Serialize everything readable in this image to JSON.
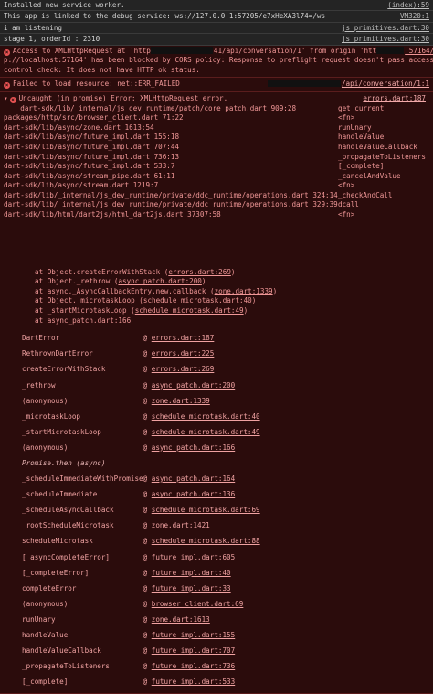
{
  "console": {
    "info_rows": [
      {
        "text": "Installed new service worker.",
        "link": "(index):59"
      },
      {
        "text": "This app is linked to the debug service: ws://127.0.0.1:57205/e7xHeXA3l74=/ws",
        "link": "VM320:1"
      },
      {
        "text": "i am listening",
        "link": "js_primitives.dart:30"
      },
      {
        "text": "stage 1, orderId : 2310",
        "link": "js_primitives.dart:30"
      }
    ],
    "cors_error": {
      "line1_a": "Access to XMLHttpRequest at 'http",
      "line1_b": "41/api/conversation/1' from origin 'htt",
      "line1_c": ":57164/#/:1",
      "line2": "p://localhost:57164' has been blocked by CORS policy: Response to preflight request doesn't pass access",
      "line3": "control check: It does not have HTTP ok status."
    },
    "failed_load": {
      "text": "Failed to load resource: net::ERR_FAILED",
      "link": "/api/conversation/1:1"
    },
    "uncaught": {
      "header": "Uncaught (in promise) Error: XMLHttpRequest error.",
      "link": "errors.dart:187",
      "grid": [
        {
          "l": "    dart-sdk/lib/_internal/js_dev_runtime/patch/core_patch.dart 909:28",
          "r": "get current"
        },
        {
          "l": "packages/http/src/browser_client.dart 71:22",
          "r": "<fn>"
        },
        {
          "l": "dart-sdk/lib/async/zone.dart 1613:54",
          "r": "runUnary"
        },
        {
          "l": "dart-sdk/lib/async/future_impl.dart 155:18",
          "r": "handleValue"
        },
        {
          "l": "dart-sdk/lib/async/future_impl.dart 707:44",
          "r": "handleValueCallback"
        },
        {
          "l": "dart-sdk/lib/async/future_impl.dart 736:13",
          "r": "_propagateToListeners"
        },
        {
          "l": "dart-sdk/lib/async/future_impl.dart 533:7",
          "r": "[_complete]"
        },
        {
          "l": "dart-sdk/lib/async/stream_pipe.dart 61:11",
          "r": "_cancelAndValue"
        },
        {
          "l": "dart-sdk/lib/async/stream.dart 1219:7",
          "r": "<fn>"
        },
        {
          "l": "dart-sdk/lib/_internal/js_dev_runtime/private/ddc_runtime/operations.dart 324:14",
          "r": "_checkAndCall"
        },
        {
          "l": "dart-sdk/lib/_internal/js_dev_runtime/private/ddc_runtime/operations.dart 329:39",
          "r": "dcall"
        },
        {
          "l": "dart-sdk/lib/html/dart2js/html_dart2js.dart 37307:58",
          "r": "<fn>"
        }
      ],
      "at_rows": [
        {
          "pre": "at Object.createErrorWithStack (",
          "link": "errors.dart:269",
          "post": ")"
        },
        {
          "pre": "at Object._rethrow (",
          "link": "async_patch.dart:200",
          "post": ")"
        },
        {
          "pre": "at async._AsyncCallbackEntry.new.callback (",
          "link": "zone.dart:1339",
          "post": ")"
        },
        {
          "pre": "at Object._microtaskLoop (",
          "link": "schedule_microtask.dart:40",
          "post": ")"
        },
        {
          "pre": "at _startMicrotaskLoop (",
          "link": "schedule_microtask.dart:49",
          "post": ")"
        },
        {
          "pre": "at async_patch.dart:166",
          "link": "",
          "post": ""
        }
      ],
      "frames": [
        {
          "fn": "DartError",
          "loc": "errors.dart:187"
        },
        {
          "fn": "RethrownDartError",
          "loc": "errors.dart:225"
        },
        {
          "fn": "createErrorWithStack",
          "loc": "errors.dart:269"
        },
        {
          "fn": "_rethrow",
          "loc": "async_patch.dart:200"
        },
        {
          "fn": "(anonymous)",
          "loc": "zone.dart:1339"
        },
        {
          "fn": "_microtaskLoop",
          "loc": "schedule_microtask.dart:40"
        },
        {
          "fn": "_startMicrotaskLoop",
          "loc": "schedule_microtask.dart:49"
        },
        {
          "fn": "(anonymous)",
          "loc": "async_patch.dart:166"
        },
        {
          "sep": "Promise.then (async)"
        },
        {
          "fn": "_scheduleImmediateWithPromise",
          "loc": "async_patch.dart:164"
        },
        {
          "fn": "_scheduleImmediate",
          "loc": "async_patch.dart:136"
        },
        {
          "fn": "_scheduleAsyncCallback",
          "loc": "schedule_microtask.dart:69"
        },
        {
          "fn": "_rootScheduleMicrotask",
          "loc": "zone.dart:1421"
        },
        {
          "fn": "scheduleMicrotask",
          "loc": "schedule_microtask.dart:88"
        },
        {
          "fn": "[_asyncCompleteError]",
          "loc": "future_impl.dart:605"
        },
        {
          "fn": "[_completeError]",
          "loc": "future_impl.dart:40"
        },
        {
          "fn": "completeError",
          "loc": "future_impl.dart:33"
        },
        {
          "fn": "(anonymous)",
          "loc": "browser_client.dart:69"
        },
        {
          "fn": "runUnary",
          "loc": "zone.dart:1613"
        },
        {
          "fn": "handleValue",
          "loc": "future_impl.dart:155"
        },
        {
          "fn": "handleValueCallback",
          "loc": "future_impl.dart:707"
        },
        {
          "fn": "_propagateToListeners",
          "loc": "future_impl.dart:736"
        },
        {
          "fn": "[_complete]",
          "loc": "future_impl.dart:533"
        }
      ],
      "at_symbol": "@"
    }
  }
}
